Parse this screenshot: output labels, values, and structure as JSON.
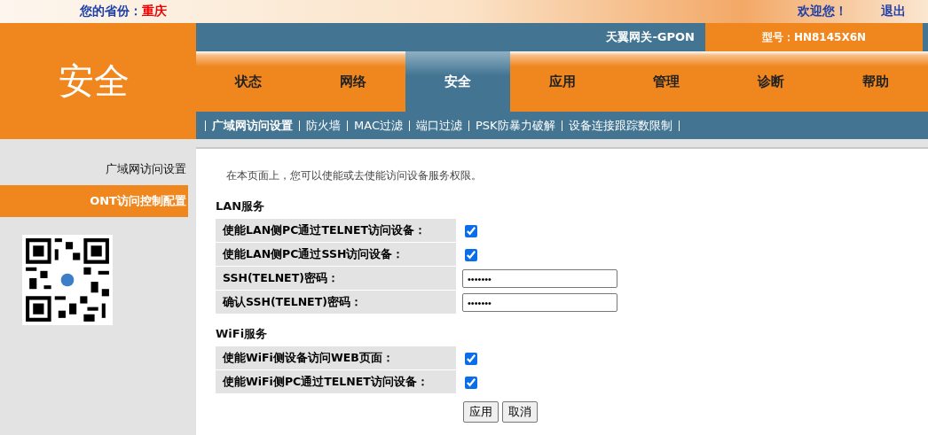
{
  "top_bar": {
    "province_label": "您的省份：",
    "province": "重庆",
    "welcome": "欢迎您！",
    "logout": "退出"
  },
  "section_title": "安全",
  "header": {
    "gateway": "天翼网关-GPON",
    "model": "型号：HN8145X6N"
  },
  "tabs": [
    {
      "label": "状态",
      "selected": false
    },
    {
      "label": "网络",
      "selected": false
    },
    {
      "label": "安全",
      "selected": true
    },
    {
      "label": "应用",
      "selected": false
    },
    {
      "label": "管理",
      "selected": false
    },
    {
      "label": "诊断",
      "selected": false
    },
    {
      "label": "帮助",
      "selected": false
    }
  ],
  "sub_tabs": [
    {
      "label": "广域网访问设置",
      "selected": true
    },
    {
      "label": "防火墙",
      "selected": false
    },
    {
      "label": "MAC过滤",
      "selected": false
    },
    {
      "label": "端口过滤",
      "selected": false
    },
    {
      "label": "PSK防暴力破解",
      "selected": false
    },
    {
      "label": "设备连接跟踪数限制",
      "selected": false
    }
  ],
  "sidebar": {
    "items": [
      {
        "label": "广域网访问设置",
        "selected": false
      },
      {
        "label": "ONT访问控制配置",
        "selected": true
      }
    ]
  },
  "content": {
    "intro": "在本页面上，您可以使能或去使能访问设备服务权限。",
    "sections": [
      {
        "title": "LAN服务",
        "rows": [
          {
            "kind": "checkbox",
            "label": "使能LAN侧PC通过TELNET访问设备：",
            "checked": true
          },
          {
            "kind": "checkbox",
            "label": "使能LAN侧PC通过SSH访问设备：",
            "checked": true
          },
          {
            "kind": "password",
            "label": "SSH(TELNET)密码：",
            "value": "•••••••"
          },
          {
            "kind": "password",
            "label": "确认SSH(TELNET)密码：",
            "value": "•••••••"
          }
        ]
      },
      {
        "title": "WiFi服务",
        "rows": [
          {
            "kind": "checkbox",
            "label": "使能WiFi侧设备访问WEB页面：",
            "checked": true
          },
          {
            "kind": "checkbox",
            "label": "使能WiFi侧PC通过TELNET访问设备：",
            "checked": true
          }
        ]
      }
    ],
    "buttons": [
      "应用",
      "取消"
    ]
  }
}
